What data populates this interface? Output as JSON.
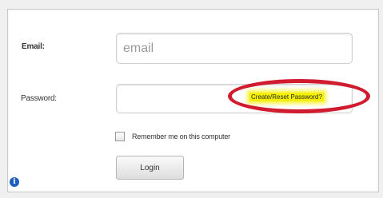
{
  "form": {
    "email_label": "Email:",
    "email_placeholder": "email",
    "email_value": "",
    "password_label": "Password:",
    "password_value": "",
    "reset_link_label": "Create/Reset Password?",
    "remember_label": "Remember me on this computer",
    "remember_checked": false,
    "login_label": "Login"
  },
  "icons": {
    "info": "info-icon"
  },
  "colors": {
    "highlight": "#f4f000",
    "annotation_ring": "#d11b2e",
    "info_icon": "#1d5fbf"
  }
}
